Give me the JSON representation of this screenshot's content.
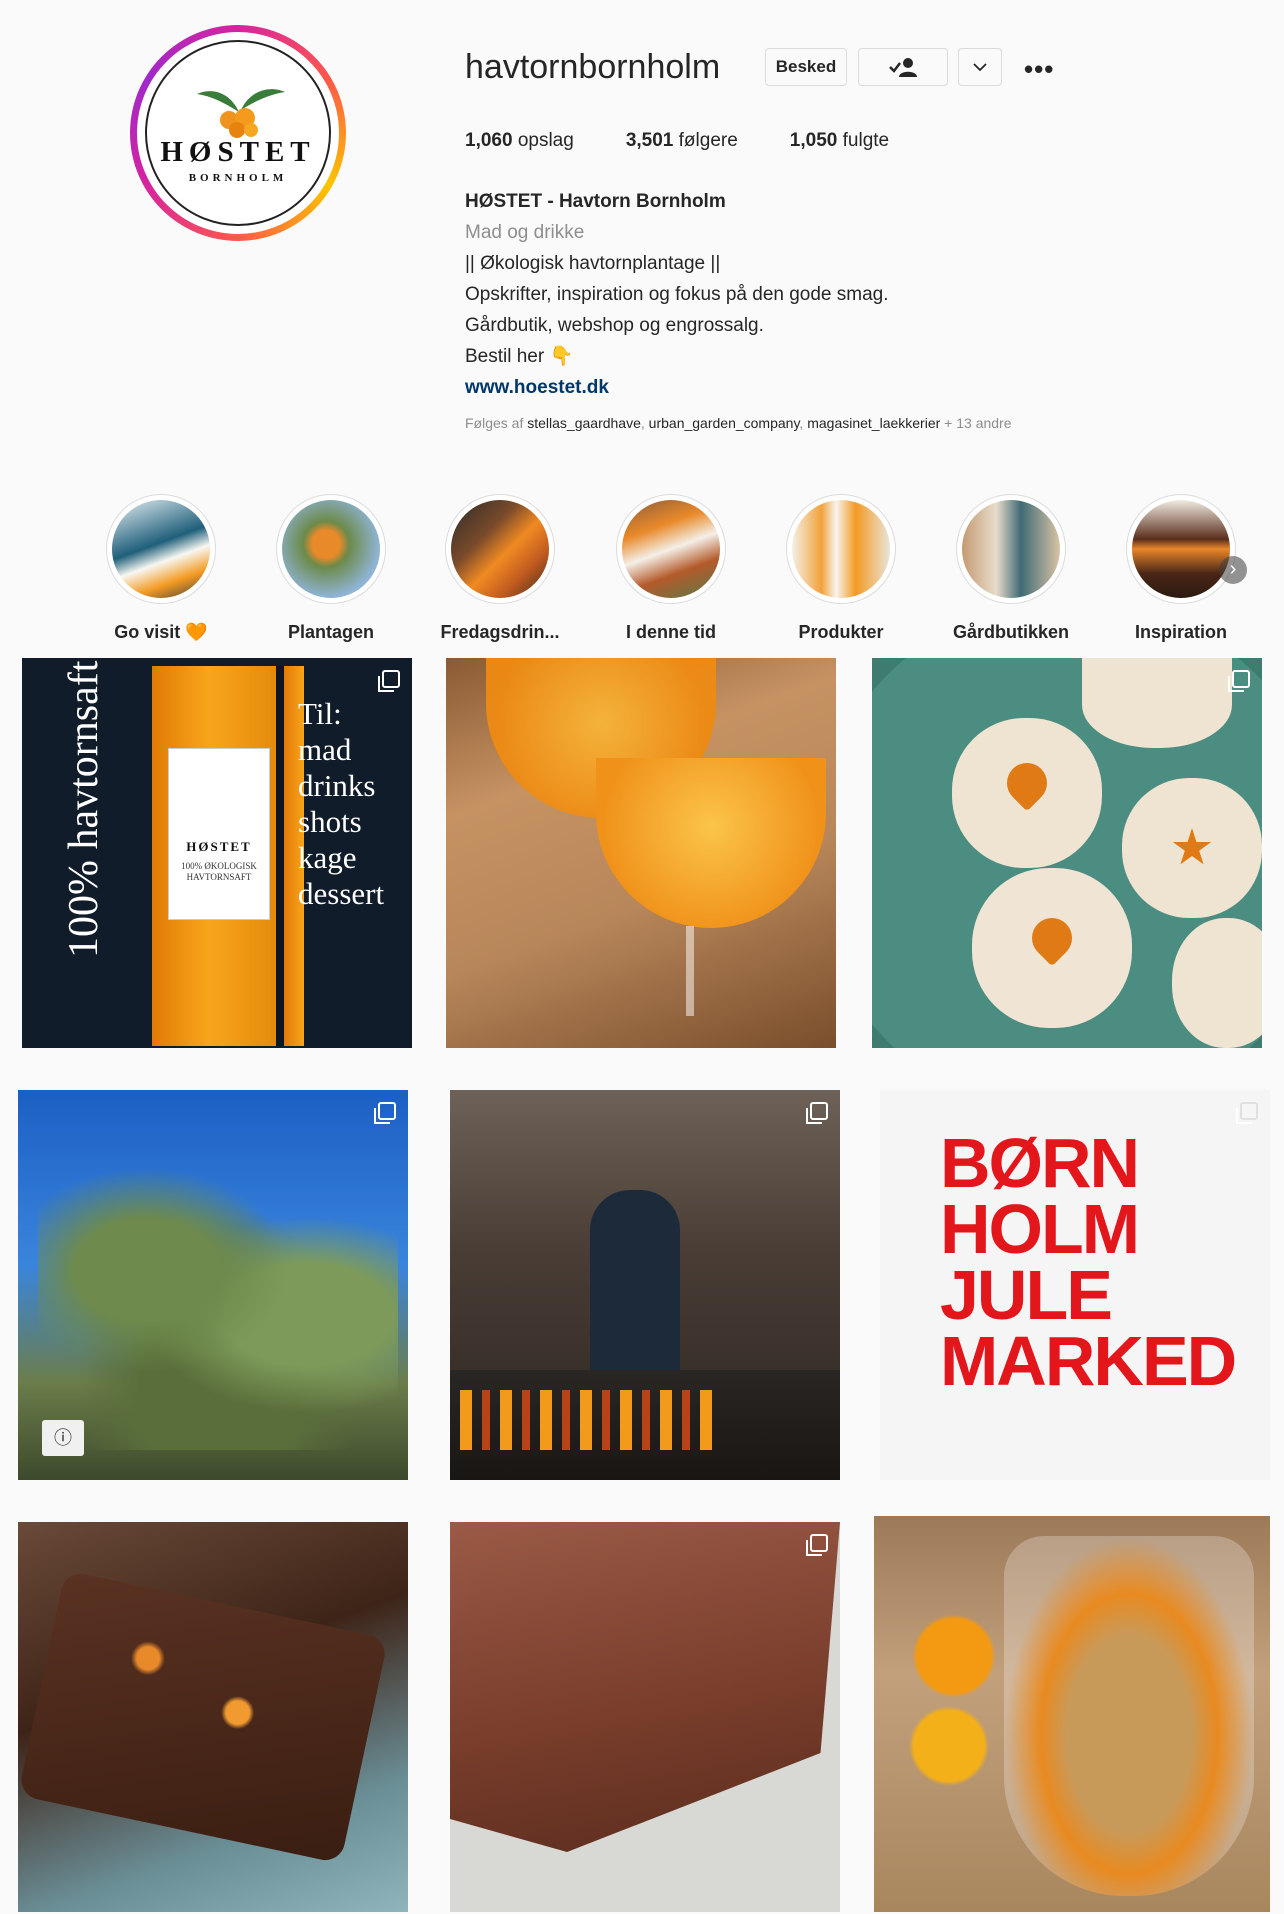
{
  "profile": {
    "username": "havtornbornholm",
    "logo_word": "HØSTET",
    "logo_sub": "BORNHOLM",
    "buttons": {
      "message": "Besked"
    },
    "stats": [
      {
        "value": "1,060",
        "label": "opslag"
      },
      {
        "value": "3,501",
        "label": "følgere"
      },
      {
        "value": "1,050",
        "label": "fulgte"
      }
    ],
    "bio": {
      "name": "HØSTET - Havtorn Bornholm",
      "category": "Mad og drikke",
      "lines": [
        "|| Økologisk havtornplantage ||",
        "Opskrifter, inspiration og fokus på den gode smag.",
        "Gårdbutik, webshop og engrossalg.",
        "Bestil her 👇"
      ],
      "link": "www.hoestet.dk"
    },
    "followed_by": {
      "prefix": "Følges af",
      "accounts": [
        "stellas_gaardhave",
        "urban_garden_company",
        "magasinet_laekkerier"
      ],
      "suffix": "+ 13 andre"
    }
  },
  "highlights": [
    {
      "label": "Go visit 🧡"
    },
    {
      "label": "Plantagen"
    },
    {
      "label": "Fredagsdrin..."
    },
    {
      "label": "I denne tid"
    },
    {
      "label": "Produkter"
    },
    {
      "label": "Gårdbutikken"
    },
    {
      "label": "Inspiration"
    }
  ],
  "posts": {
    "poster_vertical": "100% havtornsaft",
    "poster_right": [
      "Til:",
      "mad",
      "drinks",
      "shots",
      "kage",
      "dessert"
    ],
    "bottle_label": {
      "word": "HØSTET",
      "text": "100% ØKOLOGISK HAVTORNSAFT"
    },
    "julemarked": [
      "BØRN",
      "HOLM",
      "JULE",
      "MARKED"
    ]
  },
  "colors": {
    "accent_link": "#00376b",
    "jul_red": "#e3161c",
    "ring": "#d6249f"
  }
}
